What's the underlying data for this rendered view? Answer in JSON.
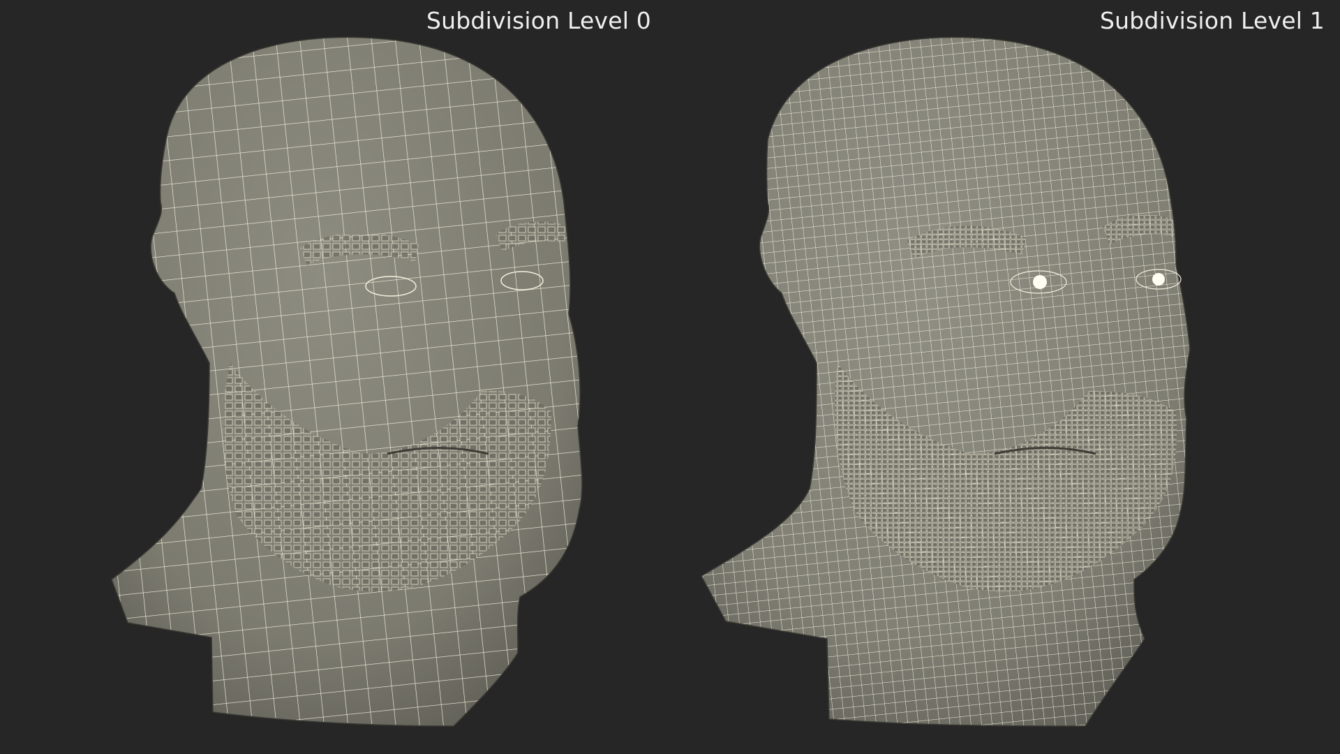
{
  "panels": [
    {
      "caption": "Subdivision Level 0",
      "mesh_density": "low"
    },
    {
      "caption": "Subdivision Level 1",
      "mesh_density": "high"
    }
  ],
  "colors": {
    "background": "#262626",
    "surface": "#7f7e73",
    "wire": "#f4f1de",
    "caption": "#f0f0f0"
  }
}
